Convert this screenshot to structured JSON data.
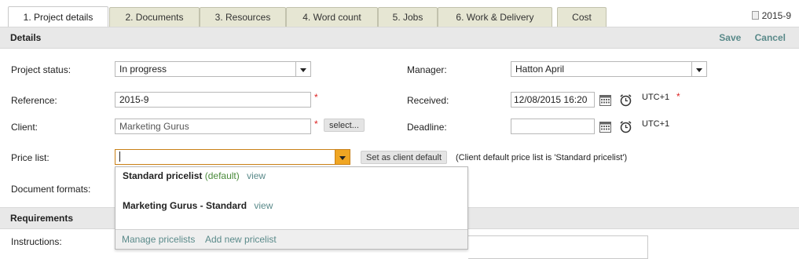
{
  "tabs": [
    {
      "label": "1. Project details",
      "active": true
    },
    {
      "label": "2. Documents"
    },
    {
      "label": "3. Resources"
    },
    {
      "label": "4. Word count"
    },
    {
      "label": "5. Jobs"
    },
    {
      "label": "6. Work & Delivery"
    },
    {
      "label": "Cost"
    }
  ],
  "project_id": "2015-9",
  "details": {
    "title": "Details",
    "save": "Save",
    "cancel": "Cancel"
  },
  "form": {
    "project_status_label": "Project status:",
    "project_status_value": "In progress",
    "manager_label": "Manager:",
    "manager_value": "Hatton April",
    "reference_label": "Reference:",
    "reference_value": "2015-9",
    "received_label": "Received:",
    "received_value": "12/08/2015 16:20",
    "received_tz": "UTC+1",
    "client_label": "Client:",
    "client_value": "Marketing Gurus",
    "select_button": "select...",
    "deadline_label": "Deadline:",
    "deadline_value": "",
    "deadline_tz": "UTC+1",
    "price_list_label": "Price list:",
    "price_list_value": "",
    "set_default_button": "Set as client default",
    "client_default_note": "(Client default price list is 'Standard pricelist')",
    "document_formats_label": "Document formats:",
    "required_mark": "*"
  },
  "dropdown": {
    "items": [
      {
        "name": "Standard pricelist",
        "tag": "(default)",
        "link": "view"
      },
      {
        "name": "Marketing Gurus - Standard",
        "link": "view"
      }
    ],
    "manage": "Manage pricelists",
    "add_new": "Add new pricelist"
  },
  "requirements": {
    "title": "Requirements",
    "instructions_label": "Instructions:"
  },
  "colors": {
    "link": "#5a8a8a",
    "accent": "#f0a623",
    "required": "#dd2222",
    "tab_bg": "#e6e6d3"
  }
}
